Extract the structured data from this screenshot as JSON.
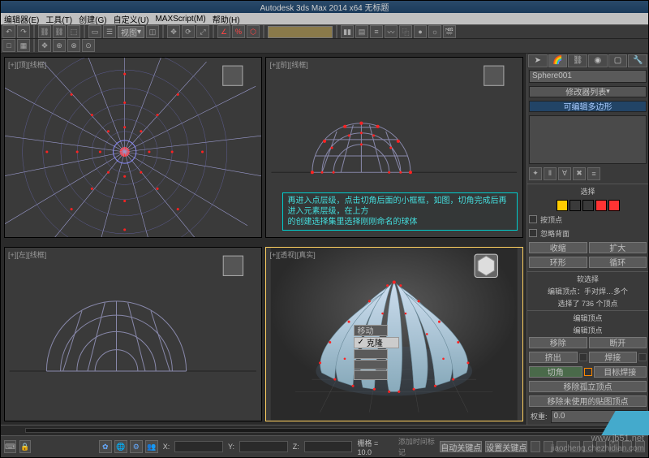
{
  "title": "Autodesk 3ds Max 2014 x64   无标题",
  "menu": [
    "编辑器(E)",
    "工具(T)",
    "创建(G)",
    "自定义(U)",
    "MAXScript(M)",
    "帮助(H)"
  ],
  "toolbar": {
    "dropdown": "视图"
  },
  "viewports": {
    "top": "[+][顶][线框]",
    "front": "[+][前][线框]",
    "left": "[+][左][线框]",
    "persp": "[+][透视][真实]"
  },
  "annotation": {
    "l1": "再进入点层级，点击切角后面的小框框，如图，切角完成后再进入元素层级，在上方",
    "l2": "的创建选择集里选择刚刚命名的球体"
  },
  "quad": {
    "move": "移动",
    "clone": "克隆"
  },
  "panel": {
    "objname": "Sphere001",
    "modlist_head": "修改器列表",
    "modifier": "可编辑多边形",
    "sel_title": "选择",
    "opt_byvert": "按顶点",
    "opt_backface": "忽略背面",
    "shrink": "收缩",
    "grow": "扩大",
    "ring": "环形",
    "loop": "循环",
    "softsel_head": "软选择",
    "softsel_sub": "编辑顶点：手对焊…多个",
    "status_sel": "选择了 736 个顶点",
    "editvert_head": "编辑顶点",
    "editvert_sub": "编辑顶点",
    "remove": "移除",
    "break": "断开",
    "extrude": "挤出",
    "weld": "焊接",
    "chamfer": "切角",
    "targetweld": "目标焊接",
    "removeiso": "移除孤立顶点",
    "removeunused": "移除未使用的贴图顶点",
    "weight_label": "权重:",
    "weight_value": "0.0"
  },
  "status": {
    "x": "X:",
    "y": "Y:",
    "z": "Z:",
    "grid": "栅格 = 10.0",
    "addtime": "添加时间标记",
    "autokey": "自动关键点",
    "setkey": "设置关键点"
  },
  "watermark": "www.jb51.net",
  "watermark2": "jiaocheng.chezhidian.com"
}
